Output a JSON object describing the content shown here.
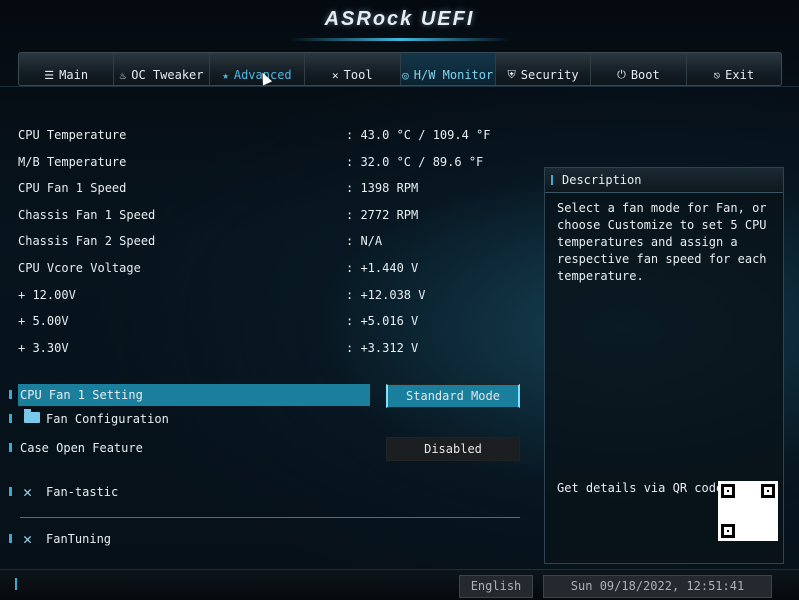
{
  "header": {
    "title": "ASRock UEFI"
  },
  "tabs": [
    {
      "label": "Main",
      "icon": "list-icon",
      "glyph": "☰"
    },
    {
      "label": "OC Tweaker",
      "icon": "flame-icon",
      "glyph": "♨"
    },
    {
      "label": "Advanced",
      "icon": "star-icon",
      "glyph": "★"
    },
    {
      "label": "Tool",
      "icon": "tool-icon",
      "glyph": "✕"
    },
    {
      "label": "H/W Monitor",
      "icon": "monitor-icon",
      "glyph": "◎"
    },
    {
      "label": "Security",
      "icon": "shield-icon",
      "glyph": "⛨"
    },
    {
      "label": "Boot",
      "icon": "power-icon",
      "glyph": "⏻"
    },
    {
      "label": "Exit",
      "icon": "exit-icon",
      "glyph": "⎋"
    }
  ],
  "active_tab": "H/W Monitor",
  "monitor": [
    {
      "label": "CPU Temperature",
      "value": ": 43.0 °C / 109.4 °F"
    },
    {
      "label": "M/B Temperature",
      "value": ": 32.0 °C /  89.6 °F"
    },
    {
      "label": "CPU Fan 1 Speed",
      "value": ": 1398 RPM"
    },
    {
      "label": "Chassis Fan 1 Speed",
      "value": ": 2772 RPM"
    },
    {
      "label": "Chassis Fan 2 Speed",
      "value": ": N/A"
    },
    {
      "label": "CPU Vcore Voltage",
      "value": ": +1.440 V"
    },
    {
      "label": "+ 12.00V",
      "value": ": +12.038 V"
    },
    {
      "label": "+ 5.00V",
      "value": ": +5.016 V"
    },
    {
      "label": "+ 3.30V",
      "value": ": +3.312 V"
    }
  ],
  "settings": {
    "cpu_fan_setting": {
      "label": "CPU Fan 1 Setting",
      "value": "Standard Mode"
    },
    "fan_configuration": {
      "label": "Fan Configuration"
    },
    "case_open": {
      "label": "Case Open Feature",
      "value": "Disabled"
    },
    "fan_tastic": {
      "label": "Fan-tastic"
    },
    "fan_tuning": {
      "label": "FanTuning"
    }
  },
  "description": {
    "title": "Description",
    "text": "Select a fan mode for Fan, or\nchoose Customize to set 5 CPU\ntemperatures and assign a\nrespective fan speed for each\ntemperature.",
    "qr_label": "Get details via QR code"
  },
  "footer": {
    "language": "English",
    "datetime": "Sun 09/18/2022, 12:51:41"
  },
  "colors": {
    "accent": "#1a7f9d",
    "highlight": "#7fd4f0"
  }
}
